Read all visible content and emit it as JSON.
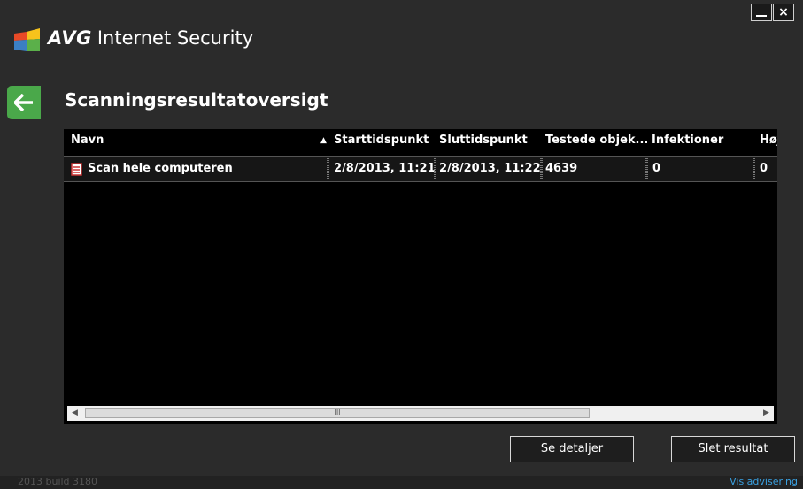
{
  "app": {
    "brand": "AVG",
    "product": "Internet Security"
  },
  "page": {
    "title": "Scanningsresultatoversigt"
  },
  "table": {
    "columns": [
      "Navn",
      "Starttidspunkt",
      "Sluttidspunkt",
      "Testede objek...",
      "Infektioner",
      "Høj"
    ],
    "sorted_column": "Navn",
    "rows": [
      {
        "name": "Scan hele computeren",
        "start": "2/8/2013, 11:21",
        "end": "2/8/2013, 11:22",
        "tested": "4639",
        "infections": "0",
        "high": "0"
      }
    ]
  },
  "buttons": {
    "details": "Se detaljer",
    "delete": "Slet resultat"
  },
  "footer": {
    "version": "2013  build 3180",
    "notifications_link": "Vis advisering"
  },
  "scrollbar": {
    "thumb_glyph": "III"
  },
  "icons": {
    "back": "arrow-left-icon",
    "row": "scan-report-icon",
    "minimize": "minimize-icon",
    "close": "close-icon"
  },
  "colors": {
    "background": "#2b2b2b",
    "back_button": "#4aa84a",
    "link": "#3aa0e0"
  }
}
